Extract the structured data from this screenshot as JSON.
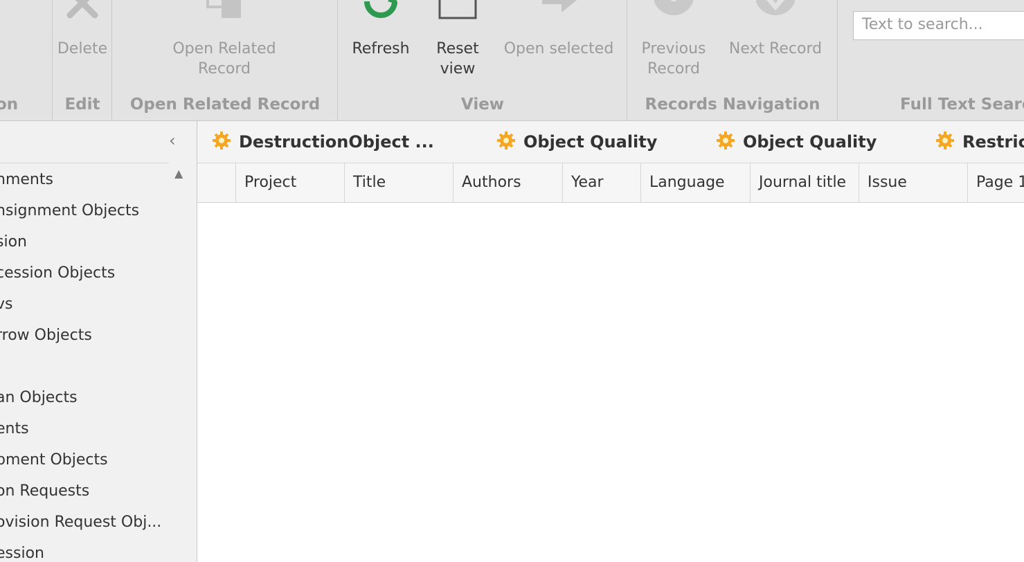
{
  "ribbon": {
    "groups": [
      {
        "caption": "on"
      },
      {
        "caption": "Edit",
        "buttons": [
          {
            "label": "Delete",
            "icon": "delete-x-icon"
          }
        ]
      },
      {
        "caption": "Open Related Record",
        "buttons": [
          {
            "label": "Open Related\nRecord",
            "icon": "open-related-record-icon"
          }
        ]
      },
      {
        "caption": "View",
        "buttons": [
          {
            "label": "Refresh",
            "icon": "refresh-icon"
          },
          {
            "label": "Reset\nview",
            "icon": "reset-view-icon"
          },
          {
            "label": "Open selected",
            "icon": "open-selected-arrow-icon"
          }
        ]
      },
      {
        "caption": "Records Navigation",
        "buttons": [
          {
            "label": "Previous\nRecord",
            "icon": "previous-record-icon"
          },
          {
            "label": "Next Record",
            "icon": "next-record-icon"
          }
        ]
      },
      {
        "caption": "Full Text Searc"
      }
    ],
    "search_placeholder": "Text to search..."
  },
  "nav": {
    "items": [
      "nments",
      "nsignment Objects",
      "sion",
      "cession Objects",
      "vs",
      "rrow Objects",
      "",
      "an Objects",
      "ents",
      "pment Objects",
      "on Requests",
      "ovision Request Obj...",
      "ession"
    ]
  },
  "tabs": [
    {
      "label": "DestructionObject ...",
      "icon": "gear-icon"
    },
    {
      "label": "Object Quality",
      "icon": "gear-icon"
    },
    {
      "label": "Object Quality",
      "icon": "gear-icon"
    },
    {
      "label": "Restric",
      "icon": "gear-icon"
    }
  ],
  "grid": {
    "columns": [
      "",
      "Project",
      "Title",
      "Authors",
      "Year",
      "Language",
      "Journal title",
      "Issue",
      "Page 1"
    ]
  },
  "colors": {
    "ribbon_bg": "#e3e3e3",
    "refresh_green": "#2e9a50",
    "gear_orange": "#f5a623"
  }
}
